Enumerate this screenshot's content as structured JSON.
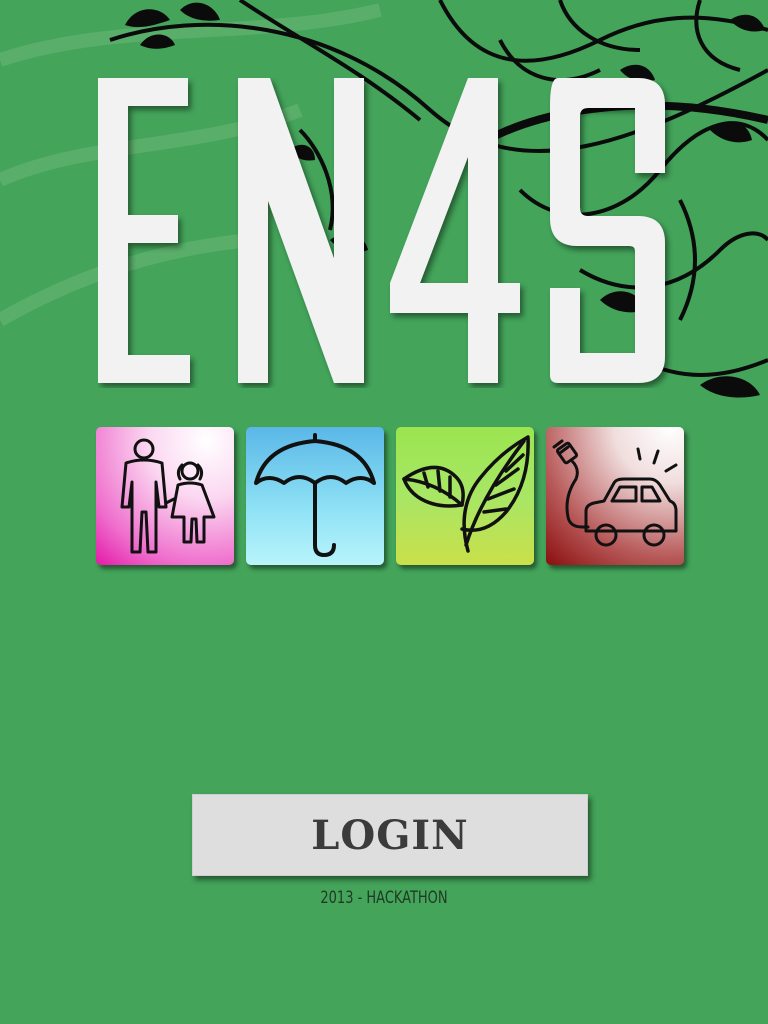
{
  "app": {
    "logo_text": "EN4S",
    "footer_text": "2013 - HACKATHON"
  },
  "login": {
    "label": "LOGIN"
  },
  "tiles": [
    {
      "icon": "family-icon",
      "colors": [
        "#e31aa9",
        "#fbd7f1"
      ]
    },
    {
      "icon": "umbrella-icon",
      "colors": [
        "#5ab7e7",
        "#b8f4fb"
      ]
    },
    {
      "icon": "leaf-icon",
      "colors": [
        "#9be54f",
        "#c9e04a"
      ]
    },
    {
      "icon": "electric-car-icon",
      "colors": [
        "#8b0d0d",
        "#f1dede"
      ]
    }
  ],
  "colors": {
    "background": "#43a45a",
    "logo": "#f2f2f2",
    "swirl": "#0b0b0b",
    "button_bg": "#dedede",
    "button_text": "#3b3b3b"
  }
}
